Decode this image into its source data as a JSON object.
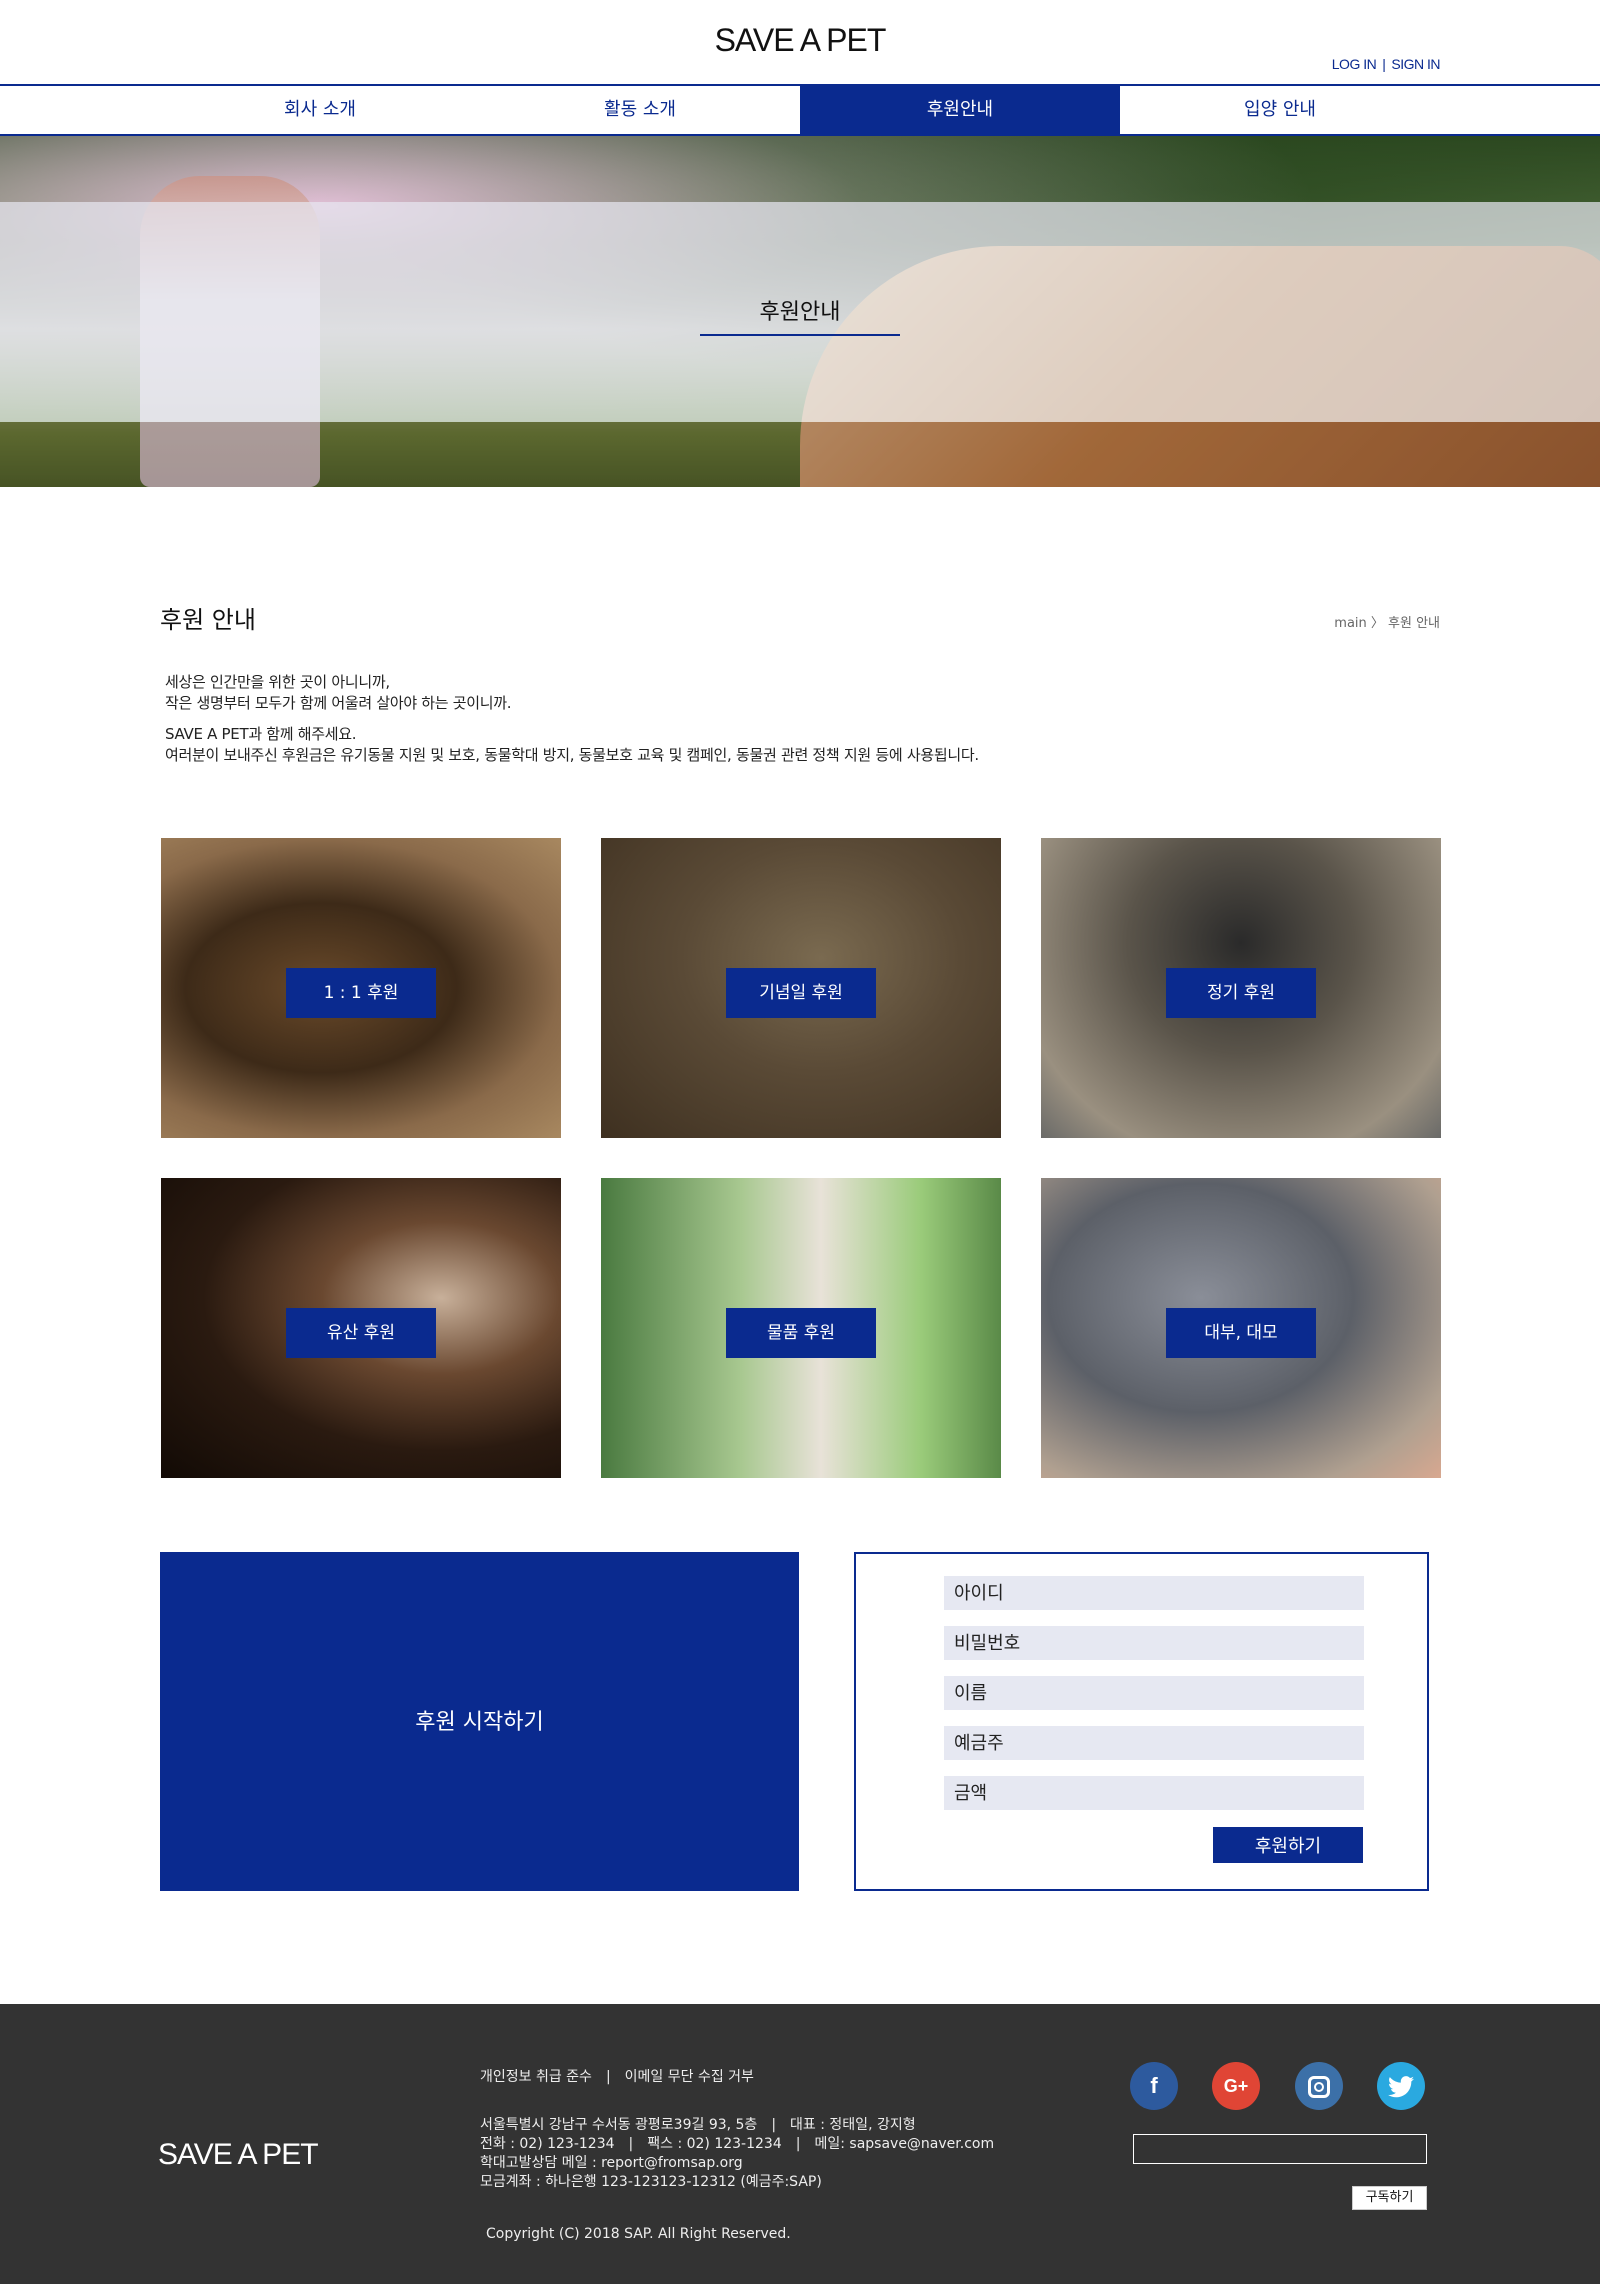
{
  "header": {
    "logo": "SAVE A PET",
    "login": "LOG IN",
    "signin": "SIGN IN",
    "separator": "|"
  },
  "nav": [
    {
      "label": "회사 소개"
    },
    {
      "label": "활동 소개"
    },
    {
      "label": "후원안내",
      "active": true
    },
    {
      "label": "입양 안내"
    }
  ],
  "hero": {
    "title": "후원안내"
  },
  "section": {
    "title": "후원 안내",
    "breadcrumb": "main 〉 후원 안내"
  },
  "intro": {
    "line1": "세상은 인간만을 위한 곳이 아니니까,",
    "line2": "작은 생명부터 모두가 함께 어울려 살아야 하는 곳이니까.",
    "line3": "SAVE A PET과 함께 해주세요.",
    "line4": "여러분이 보내주신 후원금은 유기동물 지원 및 보호, 동물학대 방지, 동물보호 교육 및 캠페인, 동물권 관련 정책 지원 등에 사용됩니다."
  },
  "cards": [
    {
      "label": "1 : 1 후원"
    },
    {
      "label": "기념일 후원"
    },
    {
      "label": "정기 후원"
    },
    {
      "label": "유산 후원"
    },
    {
      "label": "물품 후원"
    },
    {
      "label": "대부, 대모"
    }
  ],
  "start": {
    "label": "후원 시작하기"
  },
  "form": {
    "id": "아이디",
    "password": "비밀번호",
    "name": "이름",
    "depositor": "예금주",
    "amount": "금액",
    "submit": "후원하기"
  },
  "footer": {
    "logo": "SAVE A PET",
    "privacy": "개인정보 취급 준수",
    "email_refuse": "이메일 무단 수집 거부",
    "sep": "|",
    "address": "서울특별시 강남구 수서동 광평로39길 93, 5층",
    "ceo": "대표 : 정태일, 강지형",
    "phone": "전화 : 02) 123-1234",
    "fax": "팩스 : 02) 123-1234",
    "mail": "메일: sapsave@naver.com",
    "report": "학대고발상담 메일 : report@fromsap.org",
    "account": "모금계좌 : 하나은행 123-123123-12312 (예금주:SAP)",
    "copyright": "Copyright (C) 2018 SAP. All Right Reserved.",
    "subscribe": "구독하기"
  },
  "social_icons": [
    "facebook-icon",
    "google-plus-icon",
    "instagram-icon",
    "twitter-icon"
  ],
  "colors": {
    "accent": "#0a2a8f",
    "footer_bg": "#333333",
    "field_bg": "#e6e8f2"
  }
}
